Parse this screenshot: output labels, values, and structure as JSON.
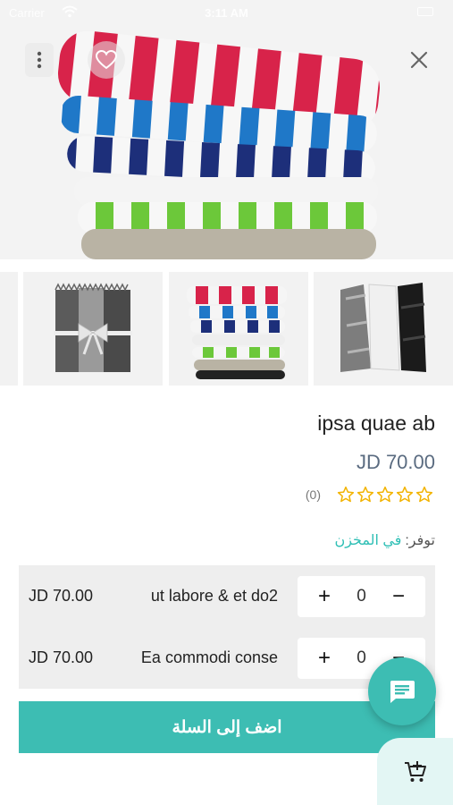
{
  "status_bar": {
    "carrier": "Carrier",
    "time": "3:11 AM"
  },
  "product": {
    "title": "ipsa quae ab",
    "price": "JD 70.00",
    "rating_count": "(0)",
    "rating_value": 0,
    "rating_max": 5,
    "availability_label": "توفر:",
    "availability_value": "في المخزن"
  },
  "variants": [
    {
      "name": "ut labore & et do2",
      "price": "JD 70.00",
      "qty": "0",
      "plus": "+",
      "minus": "−"
    },
    {
      "name": "Ea commodi conse",
      "price": "JD 70.00",
      "qty": "0",
      "plus": "+",
      "minus": "−"
    }
  ],
  "actions": {
    "add_to_cart_label": "اضف إلى السلة"
  },
  "icons": {
    "menu": "more-vertical-icon",
    "favorite": "heart-outline-icon",
    "close": "close-icon",
    "chat": "chat-bubble-icon",
    "cart": "add-to-cart-icon",
    "star": "star-outline-icon"
  },
  "colors": {
    "accent": "#3dbdb3",
    "price": "#5a6b80",
    "star": "#f2b300",
    "availability": "#2fbfb5"
  }
}
